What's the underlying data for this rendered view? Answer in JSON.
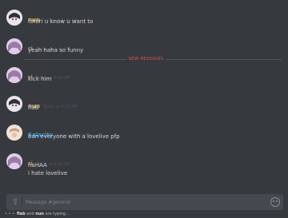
{
  "new_messages_label": "NEW MESSAGES",
  "messages": [
    {
      "user": "nun",
      "color": "#e6b54a",
      "time": "Today at 6:41 PM",
      "lines": [
        "fotori u know u want to"
      ]
    },
    {
      "user": "ri",
      "color": "#e67e22",
      "time": "Today at 6:41 PM",
      "lines": [
        "yeah haha so funny"
      ]
    },
    {
      "user": "ri",
      "color": "#e67e22",
      "time": "Today at 6:42 PM",
      "lines": [
        "kick him"
      ]
    },
    {
      "user": "nun",
      "color": "#e6b54a",
      "time": "Today at 6:42 PM",
      "lines": [
        "flab"
      ]
    },
    {
      "user": "Salacity",
      "color": "#3498db",
      "time": "Today at 6:42 PM",
      "lines": [
        "ban everyone with a lovelive pfp"
      ]
    },
    {
      "user": "ri",
      "color": "#e67e22",
      "time": "Today at 6:42 PM",
      "lines": [
        "haHAA",
        "i hate lovelive"
      ]
    }
  ],
  "composer": {
    "placeholder": "Message #general"
  },
  "typing": {
    "user1": "flab",
    "and": "and",
    "user2": "nun",
    "suffix": "are typing..."
  }
}
